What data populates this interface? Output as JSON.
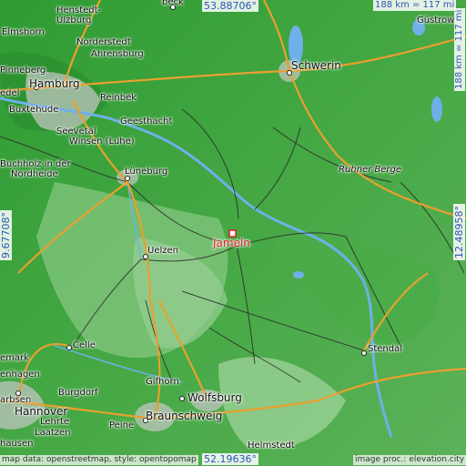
{
  "coordinates": {
    "north": "53.88706°",
    "south": "52.19636°",
    "west": "9.67708°",
    "east": "12.48958°"
  },
  "scale": {
    "horizontal": "188 km = 117 mi",
    "vertical": "188 km = 117 mi"
  },
  "target": {
    "name": "Jameln"
  },
  "places": {
    "lubeck": "beck",
    "henstedt": "Henstedt-",
    "ulzburg": "Ulzburg",
    "gustrow": "Güstrow",
    "elmshorn": "Elmshorn",
    "norderstedt": "Norderstedt",
    "ahrensburg": "Ahrensburg",
    "schwerin": "Schwerin",
    "pinneberg": "Pinneberg",
    "hamburg": "Hamburg",
    "wedel": "edel",
    "buxtehude": "Buxtehude",
    "reinbek": "Reinbek",
    "geesthacht": "Geesthacht",
    "seevetal": "Seevetal",
    "winsen": "Winsen (Luhe)",
    "buchholz_1": "Buchholz in der",
    "buchholz_2": "Nordheide",
    "luneburg": "Lüneburg",
    "ruhner_berge": "Ruhner Berge",
    "uelzen": "Uelzen",
    "celle": "Celle",
    "stendal": "Stendal",
    "wedemark": "emark",
    "langenhagen": "enhagen",
    "gifhorn": "Gifhorn",
    "burgdorf": "Burgdorf",
    "wolfsburg": "Wolfsburg",
    "garbsen": "arbsen",
    "hannover": "Hannover",
    "lehrte": "Lehrte",
    "laatzen": "Laatzen",
    "peine": "Peine",
    "braunschweig": "Braunschweig",
    "helmstedt": "Helmstedt",
    "hausen": "hausen"
  },
  "attribution": {
    "left": "map data: openstreetmap, style: opentopomap",
    "right": "image proc.: elevation.city"
  },
  "colors": {
    "lowland": "#3aa53a",
    "upland": "#7cc27a",
    "road_major": "#e8a030",
    "road_minor": "#2a2a2a",
    "river": "#6fb0e8",
    "urban": "#c8c8c8",
    "label_coord": "#2a55b8",
    "target": "#e02020"
  }
}
